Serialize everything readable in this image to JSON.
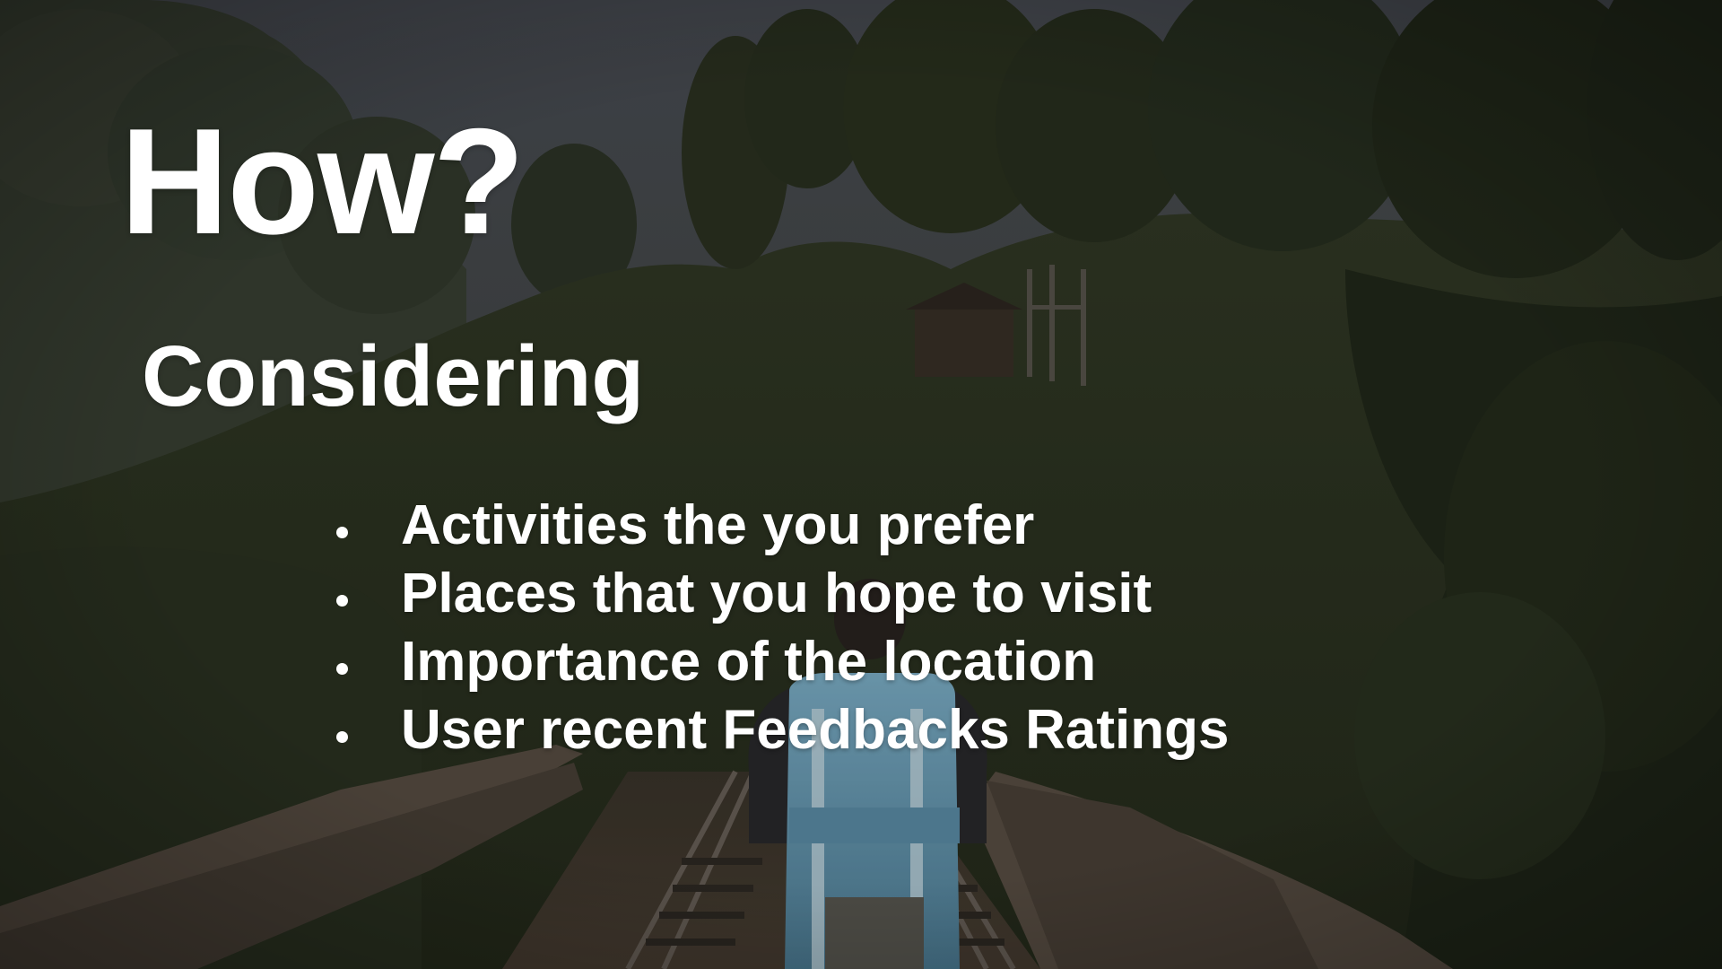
{
  "slide": {
    "title": "How?",
    "subtitle": "Considering",
    "bullets": [
      "Activities the you prefer",
      "Places that you hope to visit",
      "Importance of the location",
      "User recent Feedbacks Ratings"
    ]
  },
  "colors": {
    "text": "#ffffff",
    "sky": "#4a4e54",
    "foliage": "#2c3322",
    "backpack": "#6ea2bd"
  }
}
